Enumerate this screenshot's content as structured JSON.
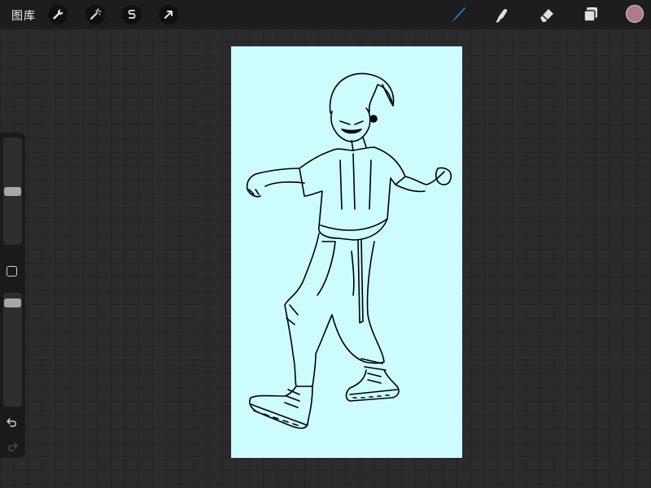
{
  "toolbar": {
    "gallery_label": "图库",
    "left_tools": [
      {
        "name": "actions",
        "icon": "wrench-icon"
      },
      {
        "name": "adjustments",
        "icon": "magic-wand-icon"
      },
      {
        "name": "selection",
        "icon": "selection-s-icon"
      },
      {
        "name": "transform",
        "icon": "arrow-icon"
      }
    ],
    "right_tools": [
      {
        "name": "brush",
        "icon": "brush-icon",
        "active": true
      },
      {
        "name": "smudge",
        "icon": "smudge-finger-icon",
        "active": false
      },
      {
        "name": "eraser",
        "icon": "eraser-icon",
        "active": false
      },
      {
        "name": "layers",
        "icon": "layers-icon",
        "active": false
      }
    ],
    "current_color": "#b07a86",
    "active_tool_color": "#2f8df5"
  },
  "sidebar": {
    "size_slider_level": 0.5,
    "opacity_slider_level": 0.95,
    "modify_button_icon": "square-icon",
    "undo_icon": "undo-icon",
    "redo_icon": "redo-icon"
  },
  "canvas": {
    "background_color": "#cdfcff",
    "artwork": "line-drawing-character"
  }
}
